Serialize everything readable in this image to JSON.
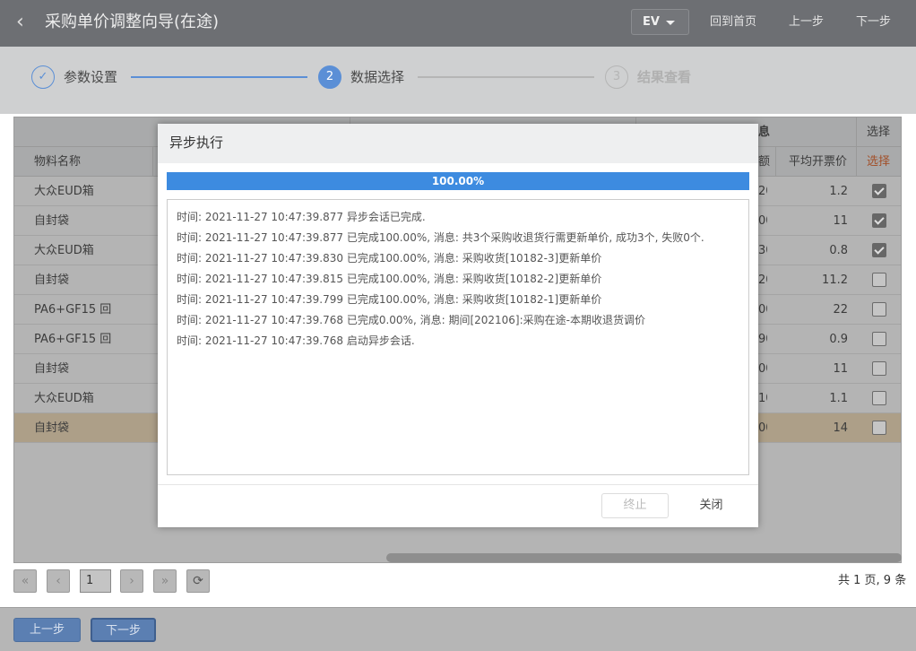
{
  "header": {
    "back_glyph": "‹",
    "title": "采购单价调整向导(在途)",
    "ev_label": "EV",
    "home_label": "回到首页",
    "prev_label": "上一步",
    "next_label": "下一步"
  },
  "steps": [
    {
      "label": "参数设置",
      "marker": "✓",
      "state": "done"
    },
    {
      "label": "数据选择",
      "marker": "2",
      "state": "active"
    },
    {
      "label": "结果查看",
      "marker": "3",
      "state": "pending"
    }
  ],
  "grid": {
    "group_header_partial": "息",
    "group_header_select": "选择",
    "col_material": "物料名称",
    "col_amount_partial": "额",
    "col_avg_price": "平均开票价",
    "col_select": "选择",
    "rows": [
      {
        "material": "大众EUD箱",
        "amount_tail": "20",
        "avg_price": "1.2",
        "checked": true
      },
      {
        "material": "自封袋",
        "amount_tail": "00",
        "avg_price": "11",
        "checked": true
      },
      {
        "material": "大众EUD箱",
        "amount_tail": "30",
        "avg_price": "0.8",
        "checked": true
      },
      {
        "material": "自封袋",
        "amount_tail": "20",
        "avg_price": "11.2",
        "checked": false
      },
      {
        "material": "PA6+GF15 回",
        "amount_tail": "00",
        "avg_price": "22",
        "checked": false
      },
      {
        "material": "PA6+GF15 回",
        "amount_tail": "90",
        "avg_price": "0.9",
        "checked": false
      },
      {
        "material": "自封袋",
        "amount_tail": "00",
        "avg_price": "11",
        "checked": false
      },
      {
        "material": "大众EUD箱",
        "amount_tail": "10",
        "avg_price": "1.1",
        "checked": false
      },
      {
        "material": "自封袋",
        "amount_tail": "00",
        "avg_price": "14",
        "checked": false
      }
    ]
  },
  "pager": {
    "first": "«",
    "prev": "‹",
    "page": "1",
    "next": "›",
    "last": "»",
    "refresh": "⟳",
    "info": "共 1 页, 9 条"
  },
  "footer": {
    "prev_label": "上一步",
    "next_label": "下一步"
  },
  "modal": {
    "title": "异步执行",
    "progress_text": "100.00%",
    "progress_value": 100,
    "log": [
      "时间: 2021-11-27 10:47:39.877 异步会话已完成.",
      "时间: 2021-11-27 10:47:39.877 已完成100.00%, 消息: 共3个采购收退货行需更新单价, 成功3个, 失败0个.",
      "时间: 2021-11-27 10:47:39.830 已完成100.00%, 消息: 采购收货[10182-3]更新单价",
      "时间: 2021-11-27 10:47:39.815 已完成100.00%, 消息: 采购收货[10182-2]更新单价",
      "时间: 2021-11-27 10:47:39.799 已完成100.00%, 消息: 采购收货[10182-1]更新单价",
      "时间: 2021-11-27 10:47:39.768 已完成0.00%, 消息: 期间[202106]:采购在途-本期收退货调价",
      "时间: 2021-11-27 10:47:39.768 启动异步会话."
    ],
    "stop_label": "终止",
    "close_label": "关闭"
  },
  "colors": {
    "accent": "#3d8be0",
    "step_done": "#5b8fd6",
    "select_header": "#e0703c",
    "highlight_row": "#e9d9c1"
  }
}
